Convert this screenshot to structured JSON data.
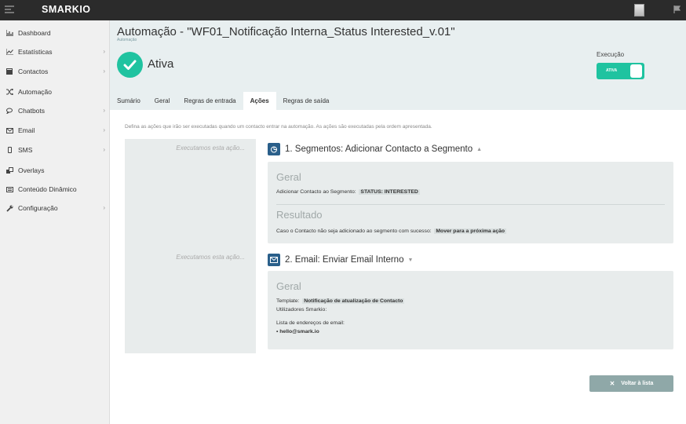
{
  "app": {
    "logo": "SMARKIO"
  },
  "sidebar": {
    "items": [
      {
        "label": "Dashboard",
        "icon": "dashboard-icon",
        "chevron": false
      },
      {
        "label": "Estatísticas",
        "icon": "chart-icon",
        "chevron": true
      },
      {
        "label": "Contactos",
        "icon": "contacts-icon",
        "chevron": true
      },
      {
        "label": "Automação",
        "icon": "shuffle-icon",
        "chevron": false
      },
      {
        "label": "Chatbots",
        "icon": "chat-icon",
        "chevron": true
      },
      {
        "label": "Email",
        "icon": "email-icon",
        "chevron": true
      },
      {
        "label": "SMS",
        "icon": "phone-icon",
        "chevron": true
      },
      {
        "label": "Overlays",
        "icon": "overlays-icon",
        "chevron": false
      },
      {
        "label": "Conteúdo Dinâmico",
        "icon": "dynamic-content-icon",
        "chevron": false
      },
      {
        "label": "Configuração",
        "icon": "wrench-icon",
        "chevron": true
      }
    ]
  },
  "header": {
    "title": "Automação - \"WF01_Notificação Interna_Status Interested_v.01\"",
    "breadcrumb": "Automação",
    "status": "Ativa",
    "execution_label": "Execução",
    "toggle_label": "ATIVA"
  },
  "tabs": [
    {
      "label": "Sumário",
      "active": false
    },
    {
      "label": "Geral",
      "active": false
    },
    {
      "label": "Regras de entrada",
      "active": false
    },
    {
      "label": "Ações",
      "active": true
    },
    {
      "label": "Regras de saída",
      "active": false
    }
  ],
  "content": {
    "description": "Defina as ações que irão ser executadas quando um contacto entrar na automação. As ações são executadas pela ordem apresentada.",
    "left_label": "Executamos esta ação...",
    "actions": [
      {
        "title": "1. Segmentos: Adicionar Contacto a Segmento",
        "icon": "segment-icon",
        "geral_title": "Geral",
        "geral_line_label": "Adicionar Contacto ao Segmento:",
        "geral_line_value": "STATUS: INTERESTED",
        "resultado_title": "Resultado",
        "resultado_line_label": "Caso o Contacto não seja adicionado ao segmento com sucesso:",
        "resultado_line_value": "Mover para a próxima ação"
      },
      {
        "title": "2. Email: Enviar Email Interno",
        "icon": "email-icon",
        "geral_title": "Geral",
        "template_label": "Template:",
        "template_value": "Notificação de atualização de Contacto",
        "users_label": "Utilizadores Smarkio:",
        "emails_label": "Lista de endereços de email:",
        "emails": [
          "hello@smark.io"
        ]
      }
    ]
  },
  "footer": {
    "back_label": "Voltar à lista"
  },
  "colors": {
    "accent": "#1fc3a0",
    "topbar": "#2b2b2b",
    "action_icon": "#2a5f8a",
    "button": "#8fa8a8"
  }
}
